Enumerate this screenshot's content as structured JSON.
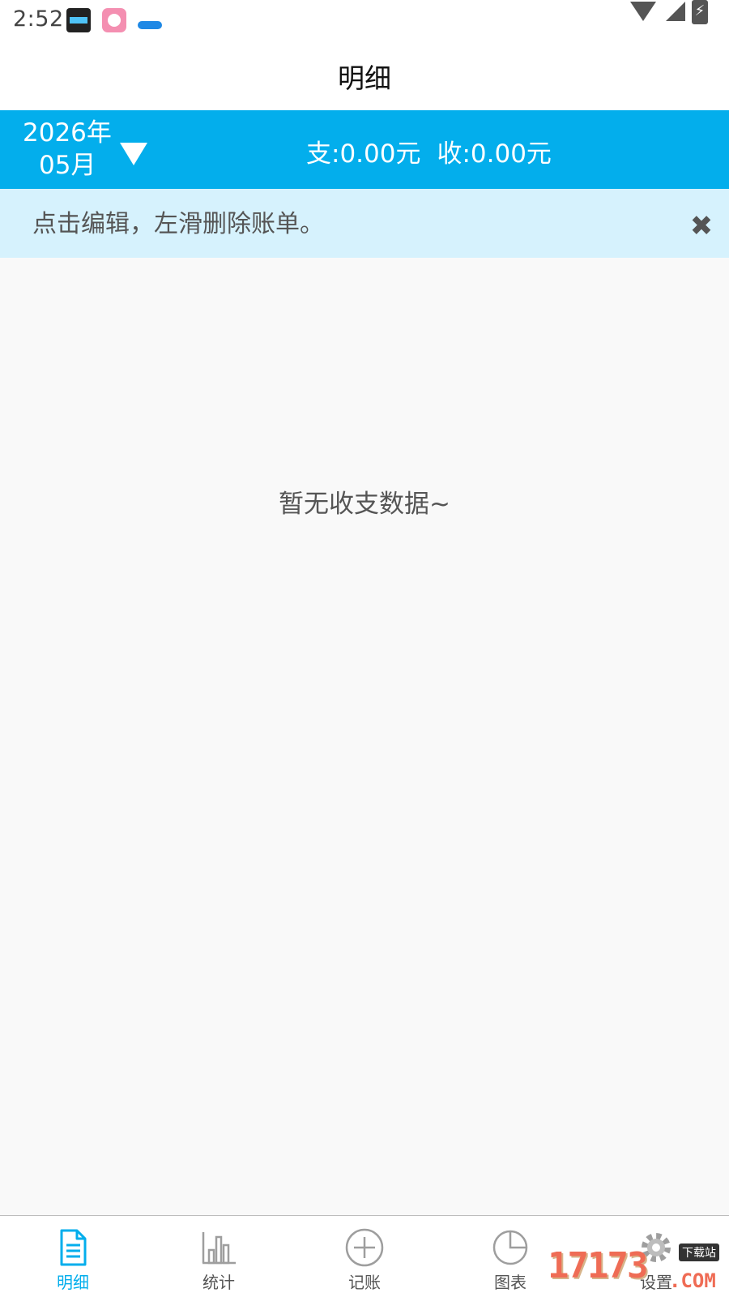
{
  "status_bar": {
    "time": "2:52"
  },
  "header": {
    "title": "明细"
  },
  "summary": {
    "year": "2026年",
    "month": "05月",
    "expense": "支:0.00元",
    "income": "收:0.00元"
  },
  "hint": {
    "text": "点击编辑，左滑删除账单。",
    "close_glyph": "✖"
  },
  "content": {
    "empty_text": "暂无收支数据~"
  },
  "bottom_nav": {
    "items": [
      {
        "label": "明细",
        "icon": "document-icon",
        "active": true
      },
      {
        "label": "统计",
        "icon": "bar-chart-icon",
        "active": false
      },
      {
        "label": "记账",
        "icon": "add-circle-icon",
        "active": false
      },
      {
        "label": "图表",
        "icon": "pie-chart-icon",
        "active": false
      },
      {
        "label": "设置",
        "icon": "gear-icon",
        "active": false
      }
    ]
  },
  "watermark": {
    "digits": "17173",
    "tag": "下载站",
    "suffix": ".COM"
  },
  "colors": {
    "accent": "#03aeec",
    "hint_bg": "#d6f2fd",
    "background": "#f9f9f9"
  }
}
